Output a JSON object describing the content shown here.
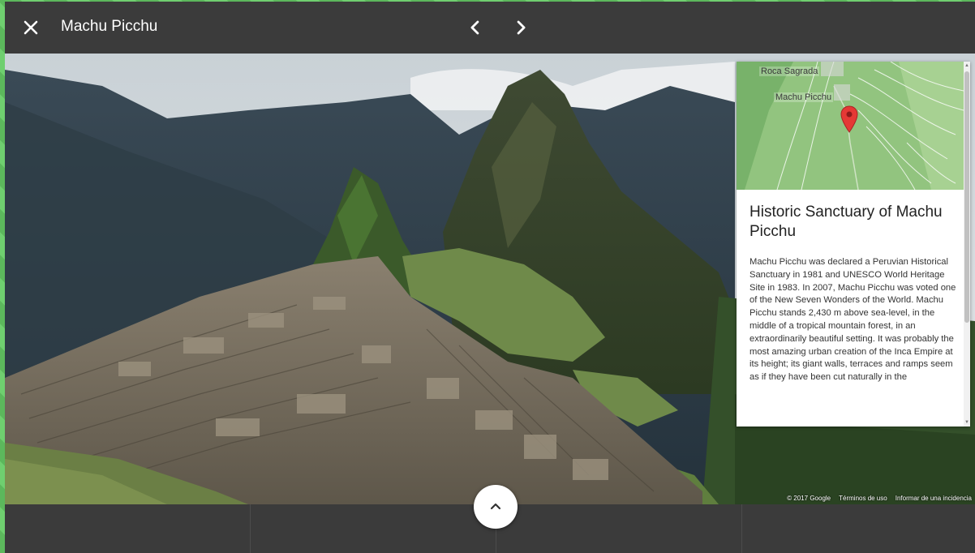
{
  "header": {
    "title": "Machu Picchu",
    "close_icon": "close-icon",
    "prev_icon": "chevron-left-icon",
    "next_icon": "chevron-right-icon"
  },
  "info_panel": {
    "map": {
      "labels": [
        "Roca Sagrada",
        "Machu Picchu"
      ],
      "marker_icon": "map-pin-icon"
    },
    "title": "Historic Sanctuary of Machu Picchu",
    "description": "Machu Picchu was declared a Peruvian Historical Sanctuary in 1981 and UNESCO World Heritage Site in 1983. In 2007, Machu Picchu was voted one of the New Seven Wonders of the World. Machu Picchu stands 2,430 m above sea-level, in the middle of a tropical mountain forest, in an extraordinarily beautiful setting. It was probably the most amazing urban creation of the Inca Empire at its height; its giant walls, terraces and ramps seem as if they have been cut naturally in the"
  },
  "attribution": {
    "copyright": "© 2017 Google",
    "terms": "Términos de uso",
    "report": "Informar de una incidencia"
  },
  "bottom": {
    "expand_icon": "chevron-up-icon"
  },
  "colors": {
    "bar": "#3b3b3b",
    "frame_green": "#5cb85c",
    "marker_red": "#e53935"
  }
}
